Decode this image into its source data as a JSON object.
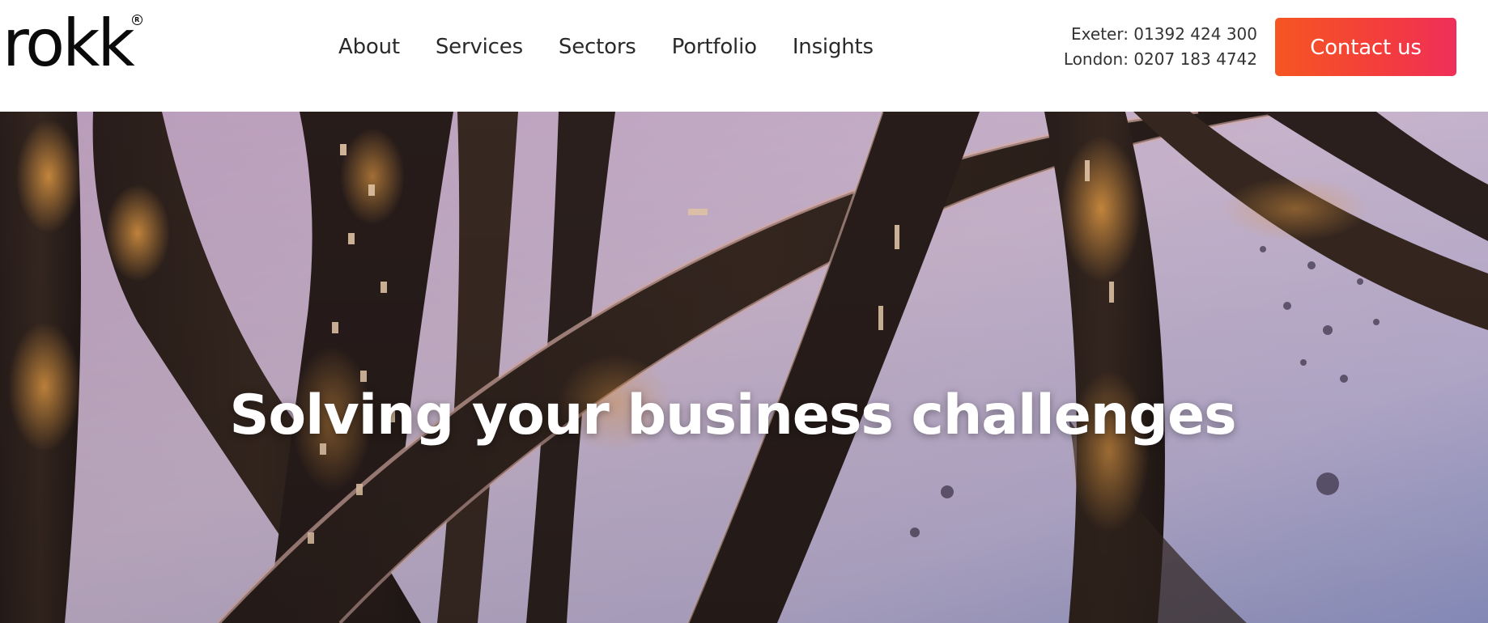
{
  "header": {
    "logo_text": "rokk",
    "logo_registered": "R",
    "nav": [
      {
        "label": "About"
      },
      {
        "label": "Services"
      },
      {
        "label": "Sectors"
      },
      {
        "label": "Portfolio"
      },
      {
        "label": "Insights"
      }
    ],
    "phones": {
      "exeter": "Exeter: 01392 424 300",
      "london": "London: 0207 183 4742"
    },
    "contact_button": "Contact us"
  },
  "hero": {
    "title": "Solving your business challenges",
    "background": "aerial-highway-interchange-snow-night"
  },
  "colors": {
    "cta_start": "#f55622",
    "cta_end": "#ef2f5a",
    "text_dark": "#2a2a2a",
    "logo": "#0a0a0a",
    "hero_text": "#ffffff"
  }
}
